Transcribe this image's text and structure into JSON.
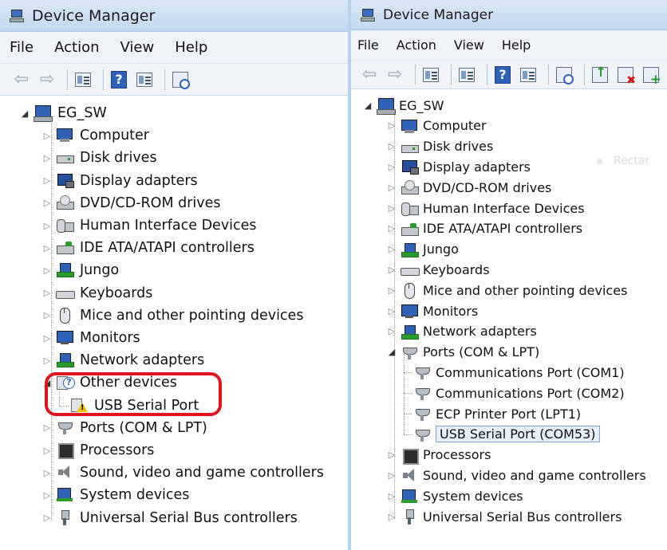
{
  "left": {
    "title": "Device Manager",
    "menu": [
      "File",
      "Action",
      "View",
      "Help"
    ],
    "root": "EG_SW",
    "items": [
      {
        "label": "Computer",
        "icon": "computer-icon"
      },
      {
        "label": "Disk drives",
        "icon": "disk-drive-icon"
      },
      {
        "label": "Display adapters",
        "icon": "display-adapter-icon"
      },
      {
        "label": "DVD/CD-ROM drives",
        "icon": "dvd-drive-icon"
      },
      {
        "label": "Human Interface Devices",
        "icon": "hid-icon"
      },
      {
        "label": "IDE ATA/ATAPI controllers",
        "icon": "ide-controller-icon"
      },
      {
        "label": "Jungo",
        "icon": "network-icon"
      },
      {
        "label": "Keyboards",
        "icon": "keyboard-icon"
      },
      {
        "label": "Mice and other pointing devices",
        "icon": "mouse-icon"
      },
      {
        "label": "Monitors",
        "icon": "monitor-icon"
      },
      {
        "label": "Network adapters",
        "icon": "network-adapter-icon"
      },
      {
        "label": "Other devices",
        "icon": "unknown-device-icon",
        "expanded": true
      },
      {
        "label": "USB Serial Port",
        "icon": "warning-device-icon",
        "child": true
      },
      {
        "label": "Ports (COM & LPT)",
        "icon": "port-icon"
      },
      {
        "label": "Processors",
        "icon": "processor-icon"
      },
      {
        "label": "Sound, video and game controllers",
        "icon": "sound-icon"
      },
      {
        "label": "System devices",
        "icon": "system-device-icon"
      },
      {
        "label": "Universal Serial Bus controllers",
        "icon": "usb-icon"
      }
    ]
  },
  "right": {
    "title": "Device Manager",
    "menu": [
      "File",
      "Action",
      "View",
      "Help"
    ],
    "root": "EG_SW",
    "items": [
      {
        "label": "Computer",
        "icon": "computer-icon"
      },
      {
        "label": "Disk drives",
        "icon": "disk-drive-icon"
      },
      {
        "label": "Display adapters",
        "icon": "display-adapter-icon"
      },
      {
        "label": "DVD/CD-ROM drives",
        "icon": "dvd-drive-icon"
      },
      {
        "label": "Human Interface Devices",
        "icon": "hid-icon"
      },
      {
        "label": "IDE ATA/ATAPI controllers",
        "icon": "ide-controller-icon"
      },
      {
        "label": "Jungo",
        "icon": "network-icon"
      },
      {
        "label": "Keyboards",
        "icon": "keyboard-icon"
      },
      {
        "label": "Mice and other pointing devices",
        "icon": "mouse-icon"
      },
      {
        "label": "Monitors",
        "icon": "monitor-icon"
      },
      {
        "label": "Network adapters",
        "icon": "network-adapter-icon"
      },
      {
        "label": "Ports (COM & LPT)",
        "icon": "port-icon",
        "expanded": true
      },
      {
        "label": "Communications Port (COM1)",
        "icon": "port-icon",
        "child": true
      },
      {
        "label": "Communications Port (COM2)",
        "icon": "port-icon",
        "child": true
      },
      {
        "label": "ECP Printer Port (LPT1)",
        "icon": "port-icon",
        "child": true
      },
      {
        "label": "USB Serial Port (COM53)",
        "icon": "port-icon",
        "child": true,
        "selected": true
      },
      {
        "label": "Processors",
        "icon": "processor-icon"
      },
      {
        "label": "Sound, video and game controllers",
        "icon": "sound-icon"
      },
      {
        "label": "System devices",
        "icon": "system-device-icon"
      },
      {
        "label": "Universal Serial Bus controllers",
        "icon": "usb-icon"
      }
    ],
    "ghost_text": "Rectar"
  }
}
